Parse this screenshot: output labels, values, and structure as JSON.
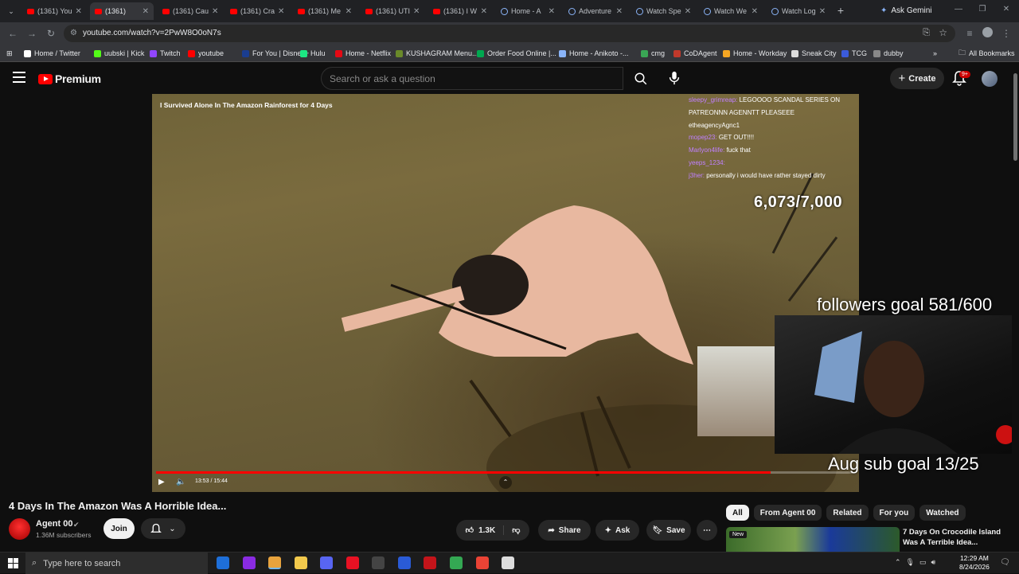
{
  "browser": {
    "tabs": [
      {
        "label": "(1361) You",
        "type": "youtube"
      },
      {
        "label": "(1361)",
        "type": "youtube",
        "active": true
      },
      {
        "label": "(1361) Cau",
        "type": "youtube"
      },
      {
        "label": "(1361) Cra",
        "type": "youtube"
      },
      {
        "label": "(1361) Me",
        "type": "youtube"
      },
      {
        "label": "(1361) UTI",
        "type": "youtube"
      },
      {
        "label": "(1361) I W",
        "type": "youtube"
      },
      {
        "label": "Home - A",
        "type": "globe"
      },
      {
        "label": "Adventure",
        "type": "globe"
      },
      {
        "label": "Watch Spe",
        "type": "globe"
      },
      {
        "label": "Watch We",
        "type": "globe"
      },
      {
        "label": "Watch Log",
        "type": "globe"
      }
    ],
    "ask_gemini": "Ask Gemini",
    "url": "youtube.com/watch?v=2PwW8O0oN7s",
    "bookmarks": [
      {
        "label": "Home / Twitter",
        "color": "#ffffff"
      },
      {
        "label": "uubski | Kick",
        "color": "#53fc18"
      },
      {
        "label": "Twitch",
        "color": "#9146ff"
      },
      {
        "label": "youtube",
        "color": "#ff0000"
      },
      {
        "label": "For You | Disney+",
        "color": "#1a3d8f"
      },
      {
        "label": "Hulu",
        "color": "#1ce783"
      },
      {
        "label": "Home - Netflix",
        "color": "#e50914"
      },
      {
        "label": "KUSHAGRAM Menu...",
        "color": "#6a8a2a"
      },
      {
        "label": "Order Food Online |...",
        "color": "#00a850"
      },
      {
        "label": "Home - Anikoto -...",
        "color": "#8ab4f8"
      },
      {
        "label": "cmg",
        "color": "#3aa655"
      },
      {
        "label": "CoDAgent",
        "color": "#c0392b"
      },
      {
        "label": "Home - Workday",
        "color": "#f5a623"
      },
      {
        "label": "Sneak City",
        "color": "#dddddd"
      },
      {
        "label": "TCG",
        "color": "#3b5bdb"
      },
      {
        "label": "dubby",
        "color": "#888888"
      }
    ],
    "all_bookmarks": "All Bookmarks"
  },
  "youtube": {
    "logo_text": "Premium",
    "search_placeholder": "Search or ask a question",
    "create_label": "Create",
    "notif_count": "9+"
  },
  "video": {
    "overlay_title": "I Survived Alone In The Amazon Rainforest for 4 Days",
    "time": "13:53 / 15:44",
    "progress": 0.882,
    "chat": [
      {
        "user": "sleepy_grimreap:",
        "msg": " LEGOOOO SCANDAL SERIES ON PATREONNN AGENNTT PLEASEEE"
      },
      {
        "user": "",
        "msg": "etheagencyAgnc1"
      },
      {
        "user": "mopep23:",
        "msg": " GET OUT!!!!"
      },
      {
        "user": "Marlyon4life:",
        "msg": " fuck that"
      },
      {
        "user": "yeeps_1234:",
        "msg": ""
      },
      {
        "user": "j3her:",
        "msg": " personally i would have rather stayed dirty"
      }
    ],
    "sub_counter": "6,073/7,000",
    "followers_goal": "followers goal 581/600",
    "sub_goal": "Aug sub goal 13/25"
  },
  "details": {
    "title": "4 Days In The Amazon Was A Horrible Idea...",
    "channel": "Agent 00",
    "subscribers": "1.36M subscribers",
    "join": "Join",
    "likes": "1.3K",
    "share": "Share",
    "ask": "Ask",
    "save": "Save"
  },
  "sidebar": {
    "chips": [
      "All",
      "From Agent 00",
      "Related",
      "For you",
      "Watched"
    ],
    "rec_badge": "New",
    "rec_title": "7 Days On Crocodile Island Was A Terrible Idea..."
  },
  "taskbar": {
    "search_placeholder": "Type here to search",
    "time": "12:29 AM",
    "date": "8/24/2026"
  }
}
